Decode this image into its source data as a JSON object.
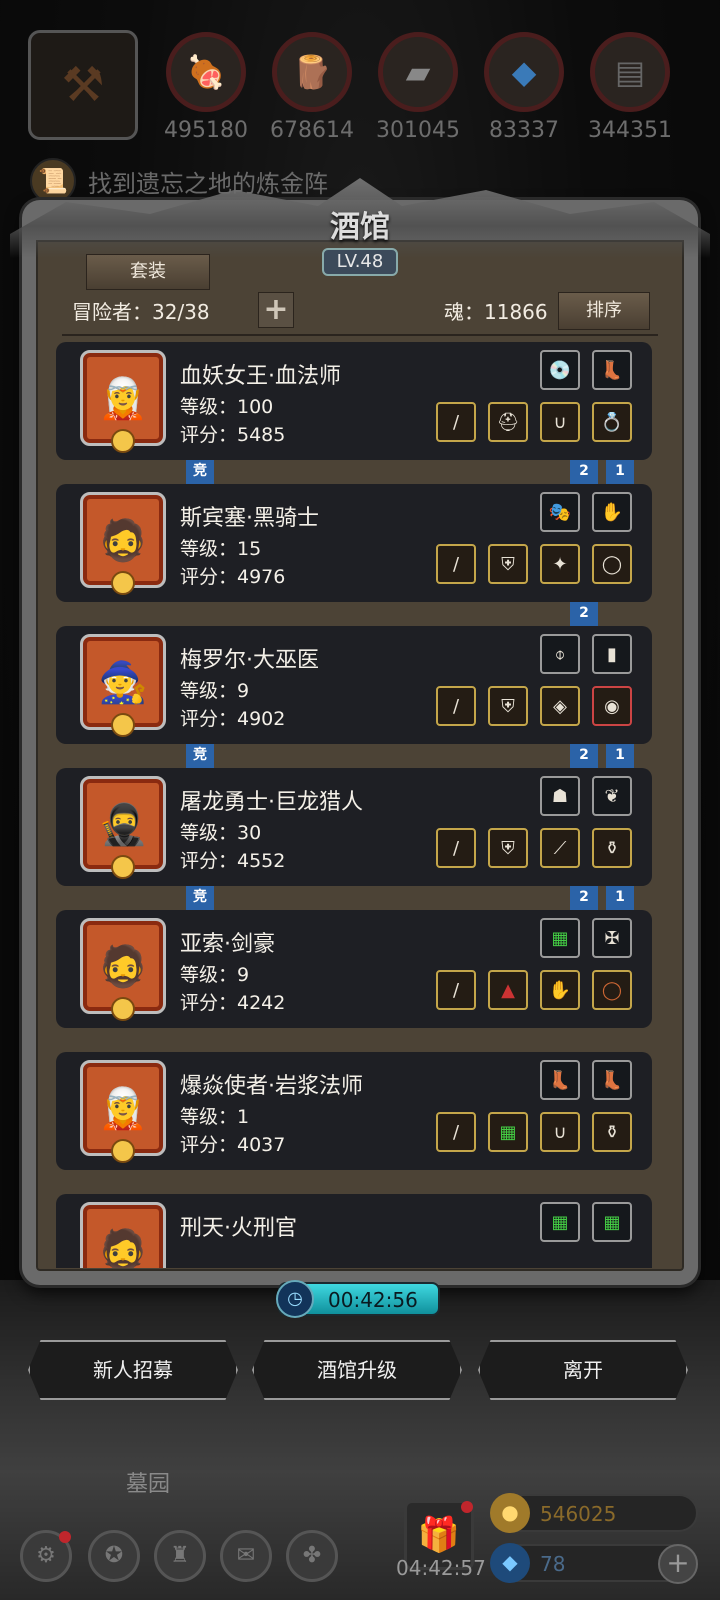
{
  "resources": {
    "items": [
      {
        "icon": "meat-icon",
        "value": "495180"
      },
      {
        "icon": "wood-icon",
        "value": "678614"
      },
      {
        "icon": "iron-ingot-icon",
        "value": "301045"
      },
      {
        "icon": "crystal-icon",
        "value": "83337"
      },
      {
        "icon": "steel-icon",
        "value": "344351"
      }
    ]
  },
  "quest": {
    "text": "找到遗忘之地的炼金阵"
  },
  "tavern": {
    "title": "酒馆",
    "level": "LV.48",
    "suit_button": "套装",
    "adventurers": "冒险者：32/38",
    "souls": "魂：11866",
    "sort_button": "排序"
  },
  "heroes": [
    {
      "name": "血妖女王·血法师",
      "level": "等级：100",
      "score": "评分：5485",
      "tags_left": [
        "竞"
      ],
      "tags_right": [
        "2",
        "1"
      ]
    },
    {
      "name": "斯宾塞·黑骑士",
      "level": "等级：15",
      "score": "评分：4976",
      "tags_left": [],
      "tags_right": [
        "2"
      ]
    },
    {
      "name": "梅罗尔·大巫医",
      "level": "等级：9",
      "score": "评分：4902",
      "tags_left": [
        "竞"
      ],
      "tags_right": [
        "2",
        "1"
      ]
    },
    {
      "name": "屠龙勇士·巨龙猎人",
      "level": "等级：30",
      "score": "评分：4552",
      "tags_left": [
        "竞"
      ],
      "tags_right": [
        "2",
        "1"
      ]
    },
    {
      "name": "亚索·剑豪",
      "level": "等级：9",
      "score": "评分：4242",
      "tags_left": [],
      "tags_right": []
    },
    {
      "name": "爆焱使者·岩浆法师",
      "level": "等级：1",
      "score": "评分：4037",
      "tags_left": [],
      "tags_right": []
    },
    {
      "name": "刑天·火刑官",
      "level": "",
      "score": "",
      "tags_left": [],
      "tags_right": []
    }
  ],
  "timer": {
    "value": "00:42:56"
  },
  "actions": {
    "recruit": "新人招募",
    "upgrade": "酒馆升级",
    "leave": "离开"
  },
  "location": {
    "name": "墓园"
  },
  "gift": {
    "timer": "04:42:57"
  },
  "currency": {
    "gold": "546025",
    "gems": "78"
  },
  "colors": {
    "accent_cyan": "#3fd8e0",
    "tag_blue": "#2b63a8",
    "panel_brown": "#4c4336",
    "card_dark": "#1e1f24",
    "equip_gold": "#c4a64a"
  }
}
